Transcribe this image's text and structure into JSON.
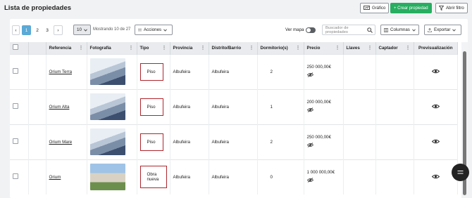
{
  "header": {
    "title": "Lista de propiedades",
    "chart_button": "Gráfico",
    "create_button": "+ Crear propiedad",
    "filter_button": "Abrir filtro"
  },
  "toolbar": {
    "pages": [
      "1",
      "2",
      "3"
    ],
    "active_page": "1",
    "prev": "‹",
    "next": "›",
    "page_size": "10",
    "showing": "Mostrando 10 de 27",
    "actions": "Acciones",
    "map_label": "Ver mapa",
    "search_placeholder": "Buscador de propiedades",
    "columns": "Columnas",
    "export": "Exportar"
  },
  "table": {
    "headers": [
      "Referencia",
      "Fotografía",
      "Tipo",
      "Provincia",
      "Distrito/Barrio",
      "Dormitorio(s)",
      "Precio",
      "Llaves",
      "Captador",
      "Previsualización"
    ],
    "rows": [
      {
        "ref": "Orium Terra",
        "tipo": "Piso",
        "provincia": "Albufeira",
        "distrito": "Albufeira",
        "dorm": "2",
        "precio": "250 000,00€",
        "photo": "interior-bedroom"
      },
      {
        "ref": "Orium Alta",
        "tipo": "Piso",
        "provincia": "Albufeira",
        "distrito": "Albufeira",
        "dorm": "1",
        "precio": "200 000,00€",
        "photo": "interior-bedroom"
      },
      {
        "ref": "Orium Mare",
        "tipo": "Piso",
        "provincia": "Albufeira",
        "distrito": "Albufeira",
        "dorm": "2",
        "precio": "250 000,00€",
        "photo": "interior-bedroom"
      },
      {
        "ref": "Orium",
        "tipo": "Obra nueva",
        "provincia": "Albufeira",
        "distrito": "Albufeira",
        "dorm": "0",
        "precio": "1 000 000,00€",
        "photo": "exterior-building"
      }
    ]
  },
  "colors": {
    "accent_green": "#27ae60",
    "active_page": "#5aa9d6",
    "highlight_border": "#b0262b"
  }
}
